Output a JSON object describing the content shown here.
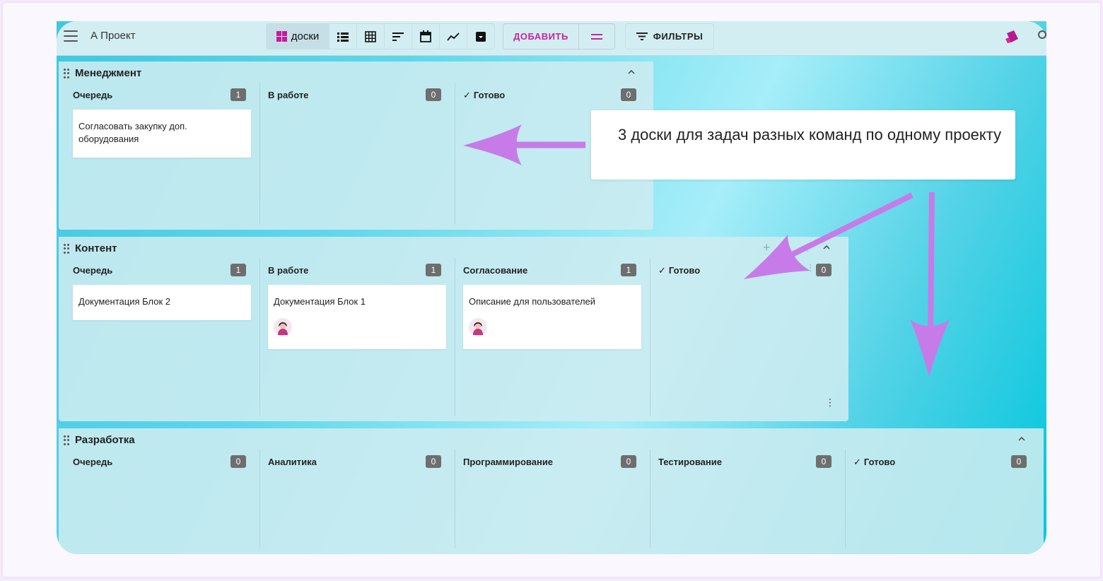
{
  "appbar": {
    "project_title": "А Проект",
    "views": [
      {
        "name": "boards",
        "label": "доски",
        "icon": "boards-icon",
        "active": true
      },
      {
        "name": "list",
        "icon": "list-icon"
      },
      {
        "name": "table",
        "icon": "table-icon"
      },
      {
        "name": "gantt",
        "icon": "gantt-icon"
      },
      {
        "name": "calendar",
        "icon": "calendar-icon"
      },
      {
        "name": "analytics",
        "icon": "chart-line-icon"
      },
      {
        "name": "archive",
        "icon": "archive-icon"
      }
    ],
    "add_label": "ДОБАВИТЬ",
    "filters_label": "ФИЛЬТРЫ",
    "accent_color": "#c4259f"
  },
  "boards": [
    {
      "title": "Менеджмент",
      "columns": [
        {
          "name": "Очередь",
          "count": "1",
          "done": false,
          "cards": [
            {
              "text": "Согласовать закупку доп. оборудования",
              "avatar": false
            }
          ]
        },
        {
          "name": "В работе",
          "count": "0",
          "done": false,
          "cards": []
        },
        {
          "name": "Готово",
          "count": "0",
          "done": true,
          "cards": []
        }
      ]
    },
    {
      "title": "Контент",
      "columns": [
        {
          "name": "Очередь",
          "count": "1",
          "done": false,
          "cards": [
            {
              "text": "Документация Блок 2",
              "avatar": false
            }
          ]
        },
        {
          "name": "В работе",
          "count": "1",
          "done": false,
          "cards": [
            {
              "text": "Документация Блок 1",
              "avatar": true
            }
          ]
        },
        {
          "name": "Согласование",
          "count": "1",
          "done": false,
          "cards": [
            {
              "text": "Описание для пользователей",
              "avatar": true
            }
          ]
        },
        {
          "name": "Готово",
          "count": "0",
          "done": true,
          "cards": []
        }
      ]
    },
    {
      "title": "Разработка",
      "columns": [
        {
          "name": "Очередь",
          "count": "0",
          "done": false,
          "cards": []
        },
        {
          "name": "Аналитика",
          "count": "0",
          "done": false,
          "cards": []
        },
        {
          "name": "Программирование",
          "count": "0",
          "done": false,
          "cards": []
        },
        {
          "name": "Тестирование",
          "count": "0",
          "done": false,
          "cards": []
        },
        {
          "name": "Готово",
          "count": "0",
          "done": true,
          "cards": []
        }
      ]
    }
  ],
  "callout": {
    "text": "3 доски для задач разных команд по одному проекту",
    "arrow_color": "#c77be8"
  }
}
